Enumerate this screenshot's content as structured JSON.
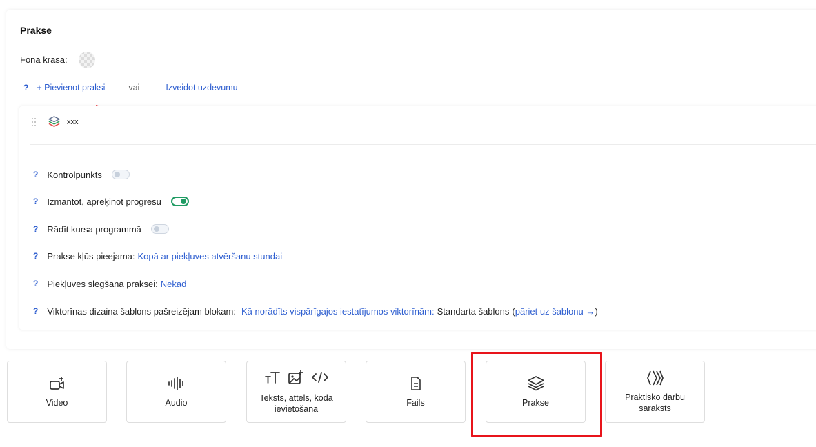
{
  "section": {
    "title": "Prakse",
    "bg_color_label": "Fona krāsa:"
  },
  "add_row": {
    "help": "?",
    "add_link": "+ Pievienot praksi",
    "or_text": "vai",
    "create_link": "Izveidot uzdevumu"
  },
  "item": {
    "name": "xxx",
    "icon": "layers-icon"
  },
  "options": [
    {
      "help": "?",
      "label": "Kontrolpunkts",
      "toggle": false
    },
    {
      "help": "?",
      "label": "Izmantot, aprēķinot progresu",
      "toggle": true
    },
    {
      "help": "?",
      "label": "Rādīt kursa programmā",
      "toggle": false
    }
  ],
  "access": {
    "help": "?",
    "label": "Prakse kļūs pieejama:",
    "value": "Kopā ar piekļuves atvēršanu stundai"
  },
  "closing": {
    "help": "?",
    "label": "Piekļuves slēgšana praksei:",
    "value": "Nekad"
  },
  "quiz_template": {
    "help": "?",
    "label": "Viktorīnas dizaina šablons pašreizējam blokam:",
    "link": "Kā norādīts vispārīgajos iestatījumos viktorīnām:",
    "value": "Standarta šablons",
    "open_paren": "(",
    "goto_link": "pāriet uz šablonu →",
    "close_paren": ")"
  },
  "tiles": [
    {
      "label": "Video",
      "icon": "video-add-icon"
    },
    {
      "label": "Audio",
      "icon": "audio-wave-icon"
    },
    {
      "label": "Teksts, attēls, koda ievietošana",
      "icon": "text-image-code-icon"
    },
    {
      "label": "Fails",
      "icon": "file-icon"
    },
    {
      "label": "Prakse",
      "icon": "layers-icon",
      "highlighted": true
    },
    {
      "label": "Praktisko darbu saraksts",
      "icon": "chevrons-list-icon"
    }
  ],
  "colors": {
    "link": "#2f5fd0",
    "toggle_on": "#1f9b63",
    "highlight": "#e8141b",
    "arrow": "#e8141b"
  }
}
